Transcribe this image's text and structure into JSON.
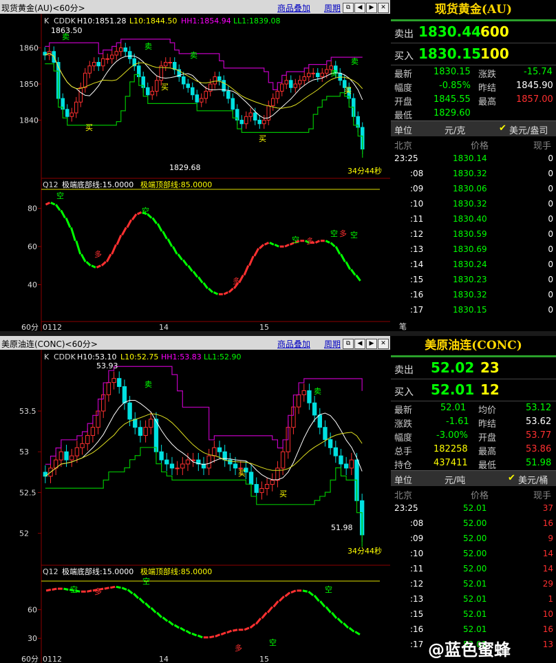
{
  "top": {
    "title": "现货黄金(AU)<60分>",
    "btn_overlay": "商品叠加",
    "btn_period": "周期",
    "icons": [
      "window-restore-icon",
      "back-icon",
      "forward-icon",
      "close-icon"
    ],
    "info_k": "K",
    "info_cddk": "CDDK",
    "info_h10": "H10:1851.28",
    "info_l10": "L10:1844.50",
    "info_hh1": "HH1:1854.94",
    "info_ll1": "LL1:1839.08",
    "y_ticks": [
      "1860",
      "1850",
      "1840"
    ],
    "high_label": "1863.50",
    "low_label": "1829.68",
    "timer": "34分44秒",
    "osc_title": "Q12",
    "osc_bottom": "极端底部线:15.0000",
    "osc_top": "极端顶部线:85.0000",
    "osc_ticks": [
      "80",
      "60",
      "40"
    ],
    "x_labels": [
      "60分",
      "0112",
      "14",
      "15"
    ],
    "signals": {
      "sell": "卖",
      "buy": "买",
      "short": "空",
      "long": "多"
    }
  },
  "bottom": {
    "title": "美原油连(CONC)<60分>",
    "btn_overlay": "商品叠加",
    "btn_period": "周期",
    "info_k": "K",
    "info_cddk": "CDDK",
    "info_h10": "H10:53.10",
    "info_l10": "L10:52.75",
    "info_hh1": "HH1:53.83",
    "info_ll1": "LL1:52.90",
    "y_ticks": [
      "53.5",
      "53.0",
      "52.5",
      "52.0"
    ],
    "high_label": "53.93",
    "low_label": "51.98",
    "timer": "34分44秒",
    "osc_title": "Q12",
    "osc_bottom": "极端底部线:15.0000",
    "osc_top": "极端顶部线:85.0000",
    "osc_ticks": [
      "60",
      "30"
    ],
    "x_labels": [
      "60分",
      "0112",
      "14",
      "15"
    ]
  },
  "quote_top": {
    "title": "现货黄金(AU)",
    "sell_label": "卖出",
    "sell_price": "1830.44",
    "sell_vol": "600",
    "buy_label": "买入",
    "buy_price": "1830.15",
    "buy_vol": "100",
    "latest_l": "最新",
    "latest": "1830.15",
    "change_l": "涨跌",
    "change": "-15.74",
    "pct_l": "幅度",
    "pct": "-0.85%",
    "prev_l": "昨结",
    "prev": "1845.90",
    "open_l": "开盘",
    "open": "1845.55",
    "high_l": "最高",
    "high": "1857.00",
    "low_l": "最低",
    "low": "1829.60",
    "unit_l": "单位",
    "unit": "元/克",
    "unit2": "美元/盎司",
    "col_time": "北京",
    "col_price": "价格",
    "col_vol": "现手",
    "ticks": [
      {
        "t": "23:25",
        "p": "1830.14",
        "v": "0"
      },
      {
        "t": ":08",
        "p": "1830.32",
        "v": "0"
      },
      {
        "t": ":09",
        "p": "1830.06",
        "v": "0"
      },
      {
        "t": ":10",
        "p": "1830.32",
        "v": "0"
      },
      {
        "t": ":11",
        "p": "1830.40",
        "v": "0"
      },
      {
        "t": ":12",
        "p": "1830.59",
        "v": "0"
      },
      {
        "t": ":13",
        "p": "1830.69",
        "v": "0"
      },
      {
        "t": ":14",
        "p": "1830.24",
        "v": "0"
      },
      {
        "t": ":15",
        "p": "1830.23",
        "v": "0"
      },
      {
        "t": ":16",
        "p": "1830.32",
        "v": "0"
      },
      {
        "t": ":17",
        "p": "1830.15",
        "v": "0"
      }
    ],
    "footer": "笔"
  },
  "quote_bot": {
    "title": "美原油连(CONC)",
    "sell_label": "卖出",
    "sell_price": "52.02",
    "sell_vol": "23",
    "buy_label": "买入",
    "buy_price": "52.01",
    "buy_vol": "12",
    "latest_l": "最新",
    "latest": "52.01",
    "avg_l": "均价",
    "avg": "53.12",
    "change_l": "涨跌",
    "change": "-1.61",
    "prev_l": "昨结",
    "prev": "53.62",
    "pct_l": "幅度",
    "pct": "-3.00%",
    "open_l": "开盘",
    "open": "53.77",
    "total_l": "总手",
    "total": "182258",
    "high_l": "最高",
    "high": "53.86",
    "oi_l": "持仓",
    "oi": "437411",
    "low_l": "最低",
    "low": "51.98",
    "unit_l": "单位",
    "unit": "元/吨",
    "unit2": "美元/桶",
    "col_time": "北京",
    "col_price": "价格",
    "col_vol": "现手",
    "ticks": [
      {
        "t": "23:25",
        "p": "52.01",
        "v": "37"
      },
      {
        "t": ":08",
        "p": "52.00",
        "v": "16"
      },
      {
        "t": ":09",
        "p": "52.00",
        "v": "9"
      },
      {
        "t": ":10",
        "p": "52.00",
        "v": "14"
      },
      {
        "t": ":11",
        "p": "52.00",
        "v": "14"
      },
      {
        "t": ":12",
        "p": "52.01",
        "v": "29"
      },
      {
        "t": ":13",
        "p": "52.01",
        "v": "1"
      },
      {
        "t": ":15",
        "p": "52.01",
        "v": "10"
      },
      {
        "t": ":16",
        "p": "52.01",
        "v": "16"
      },
      {
        "t": ":17",
        "p": "52.01",
        "v": "13"
      }
    ]
  },
  "watermark": "@蓝色蜜蜂",
  "chart_data": [
    {
      "type": "candlestick",
      "title": "现货黄金(AU)<60分>",
      "y_ticks": [
        1860,
        1850,
        1840
      ],
      "ylim": [
        1826,
        1866
      ],
      "x_tick_labels": [
        "0112",
        "14",
        "15"
      ],
      "close": [
        1858,
        1859,
        1856,
        1846,
        1843,
        1841,
        1842,
        1845,
        1849,
        1853,
        1855,
        1856,
        1855,
        1857,
        1857,
        1858,
        1859,
        1860,
        1859,
        1857,
        1855,
        1852,
        1849,
        1847,
        1848,
        1851,
        1855,
        1856,
        1856,
        1854,
        1852,
        1850,
        1849,
        1847,
        1845,
        1846,
        1848,
        1850,
        1852,
        1851,
        1848,
        1846,
        1843,
        1840,
        1839,
        1841,
        1842,
        1840,
        1839,
        1840,
        1844,
        1846,
        1848,
        1850,
        1851,
        1849,
        1850,
        1851,
        1852,
        1853,
        1853,
        1852,
        1853,
        1854,
        1855,
        1853,
        1851,
        1849,
        1846,
        1841,
        1838,
        1832
      ],
      "series": [
        {
          "name": "H10",
          "value": 1851.28
        },
        {
          "name": "L10",
          "value": 1844.5
        },
        {
          "name": "HH1",
          "value": 1854.94
        },
        {
          "name": "LL1",
          "value": 1839.08
        }
      ],
      "annotations": [
        "1863.50",
        "1829.68",
        "卖",
        "买"
      ]
    },
    {
      "type": "line",
      "title": "Q12",
      "y_ticks": [
        80,
        60,
        40
      ],
      "ylim": [
        25,
        90
      ],
      "reference_lines": [
        {
          "label": "极端底部线",
          "value": 15
        },
        {
          "label": "极端顶部线",
          "value": 85
        }
      ],
      "values": [
        82,
        83,
        82,
        79,
        75,
        70,
        63,
        56,
        52,
        50,
        49,
        50,
        52,
        56,
        61,
        66,
        70,
        74,
        77,
        78,
        77,
        75,
        72,
        68,
        64,
        60,
        56,
        53,
        50,
        47,
        44,
        41,
        38,
        36,
        35,
        35,
        36,
        38,
        41,
        45,
        50,
        55,
        59,
        61,
        62,
        61,
        60,
        60,
        61,
        62,
        63,
        63,
        62,
        62,
        63,
        63,
        62,
        60,
        56,
        52,
        48,
        45,
        42
      ]
    },
    {
      "type": "candlestick",
      "title": "美原油连(CONC)<60分>",
      "y_ticks": [
        53.5,
        53.0,
        52.5,
        52.0
      ],
      "ylim": [
        51.65,
        54.1
      ],
      "x_tick_labels": [
        "0112",
        "14",
        "15"
      ],
      "close": [
        52.7,
        52.8,
        52.9,
        53.0,
        52.9,
        52.95,
        53.05,
        53.1,
        53.2,
        53.3,
        53.5,
        53.7,
        53.85,
        53.9,
        53.8,
        53.6,
        53.4,
        53.3,
        53.2,
        53.3,
        53.4,
        53.0,
        52.9,
        52.85,
        52.8,
        52.8,
        52.85,
        52.9,
        52.9,
        52.85,
        52.8,
        52.95,
        53.05,
        53.0,
        52.9,
        52.85,
        52.8,
        52.8,
        52.75,
        52.6,
        52.5,
        52.55,
        52.6,
        52.65,
        52.8,
        53.0,
        53.3,
        53.55,
        53.7,
        53.75,
        53.6,
        53.45,
        53.3,
        53.15,
        53.05,
        52.95,
        52.85,
        52.8,
        52.9,
        52.4,
        51.98
      ],
      "series": [
        {
          "name": "H10",
          "value": 53.1
        },
        {
          "name": "L10",
          "value": 52.75
        },
        {
          "name": "HH1",
          "value": 53.83
        },
        {
          "name": "LL1",
          "value": 52.9
        }
      ],
      "annotations": [
        "53.93",
        "51.98",
        "卖",
        "买"
      ]
    },
    {
      "type": "line",
      "title": "Q12",
      "y_ticks": [
        60,
        30
      ],
      "ylim": [
        15,
        90
      ],
      "reference_lines": [
        {
          "label": "极端底部线",
          "value": 15
        },
        {
          "label": "极端顶部线",
          "value": 85
        }
      ],
      "values": [
        80,
        81,
        82,
        82,
        81,
        80,
        79,
        79,
        80,
        81,
        82,
        83,
        84,
        83,
        81,
        77,
        72,
        67,
        62,
        57,
        52,
        48,
        44,
        41,
        38,
        35,
        33,
        31,
        31,
        32,
        34,
        36,
        38,
        39,
        39,
        41,
        45,
        51,
        57,
        63,
        69,
        74,
        78,
        80,
        80,
        79,
        75,
        69,
        63,
        57,
        51,
        46,
        41,
        37,
        34
      ]
    }
  ]
}
